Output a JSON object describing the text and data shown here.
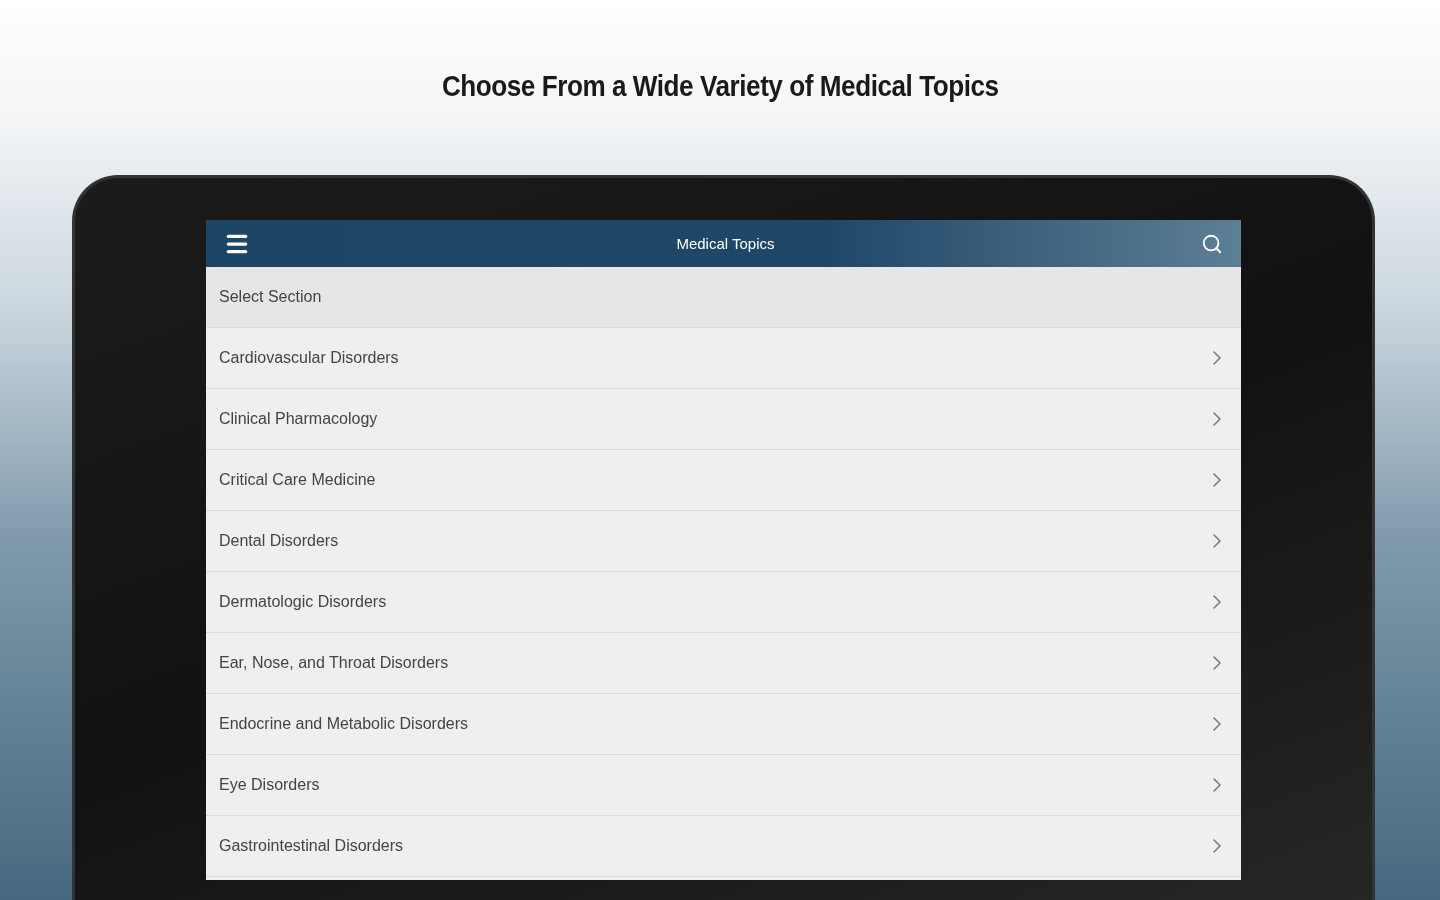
{
  "headline": "Choose From a Wide Variety of Medical Topics",
  "app": {
    "title": "Medical Topics",
    "section_header": "Select Section",
    "items": [
      "Cardiovascular Disorders",
      "Clinical Pharmacology",
      "Critical Care Medicine",
      "Dental Disorders",
      "Dermatologic Disorders",
      "Ear, Nose, and Throat Disorders",
      "Endocrine and Metabolic Disorders",
      "Eye Disorders",
      "Gastrointestinal Disorders"
    ]
  }
}
